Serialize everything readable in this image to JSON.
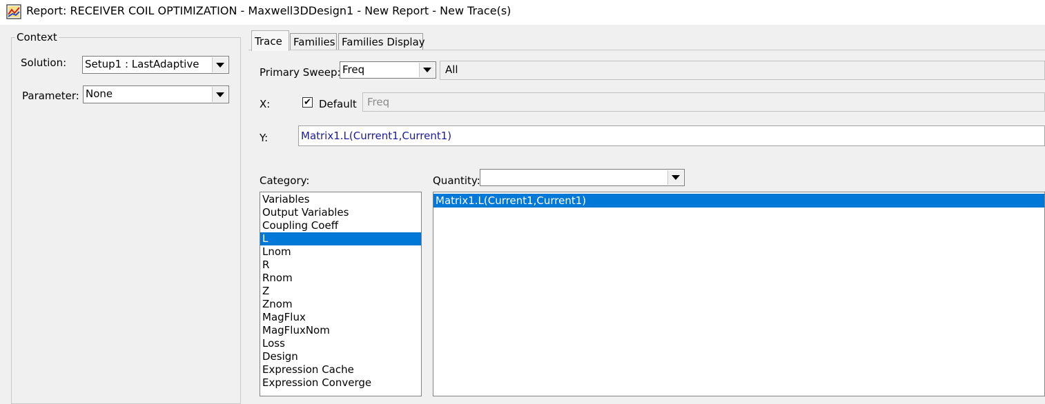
{
  "window": {
    "title": "Report: RECEIVER COIL OPTIMIZATION - Maxwell3DDesign1 - New Report - New Trace(s)",
    "icon": "report-chart-icon"
  },
  "context": {
    "group_label": "Context",
    "solution_label": "Solution:",
    "solution_value": "Setup1 : LastAdaptive",
    "parameter_label": "Parameter:",
    "parameter_value": "None"
  },
  "tabs": [
    {
      "label": "Trace",
      "active": true
    },
    {
      "label": "Families",
      "active": false
    },
    {
      "label": "Families Display",
      "active": false
    }
  ],
  "trace": {
    "primary_sweep_label": "Primary Sweep:",
    "primary_sweep_value": "Freq",
    "sweep_range": "All",
    "x_label": "X:",
    "default_label": "Default",
    "default_checked": true,
    "x_value": "Freq",
    "y_label": "Y:",
    "y_value": "Matrix1.L(Current1,Current1)",
    "category_label": "Category:",
    "quantity_label": "Quantity:",
    "quantity_filter": "",
    "categories": [
      "Variables",
      "Output Variables",
      "Coupling Coeff",
      "L",
      "Lnom",
      "R",
      "Rnom",
      "Z",
      "Znom",
      "MagFlux",
      "MagFluxNom",
      "Loss",
      "Design",
      "Expression Cache",
      "Expression Converge"
    ],
    "selected_category": "L",
    "quantities": [
      "Matrix1.L(Current1,Current1)"
    ],
    "selected_quantity": "Matrix1.L(Current1,Current1)"
  },
  "colors": {
    "selection": "#0078d7",
    "y_text": "#1a1aa6"
  }
}
